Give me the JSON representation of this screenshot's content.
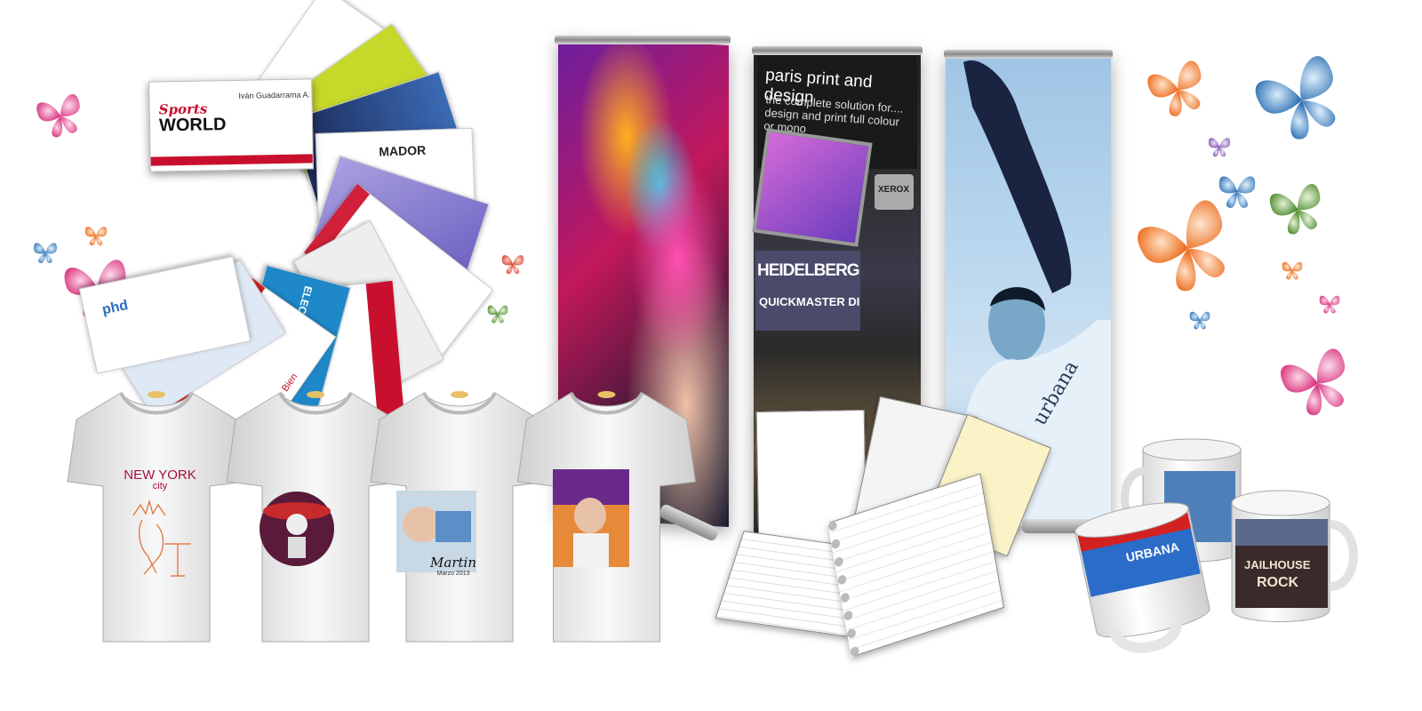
{
  "business_card": {
    "brand_top": "Sports",
    "brand_bottom": "WORLD",
    "person": "Iván Guadarrama A."
  },
  "fan_card_texts": {
    "electronic": "ELECTRONIC SYSTEMS",
    "gente": "Gente Bien",
    "mador": "MADOR",
    "phd": "phd"
  },
  "banner_paris": {
    "title": "paris print and design",
    "subtitle": "the complete solution for.... design and print full colour or mono",
    "xerox": "XEROX",
    "heidelberg": "HEIDELBERG",
    "quickmaster": "QUICKMASTER DI"
  },
  "banner_urbana": {
    "shirt_text": "urbana"
  },
  "shirts": [
    {
      "line1": "NEW YORK",
      "line2": "city"
    },
    {
      "line1": ""
    },
    {
      "line1": "Martin",
      "line2": "Marzo 2013"
    },
    {
      "line1": ""
    }
  ],
  "mugs": {
    "left_text": "URBANA",
    "right_line1": "JAILHOUSE",
    "right_line2": "ROCK"
  },
  "colors": {
    "pink": "#e0458a",
    "blue": "#3b7fc4",
    "orange": "#f07a2a",
    "green": "#5a9a3a",
    "purple": "#8e5bb5"
  }
}
